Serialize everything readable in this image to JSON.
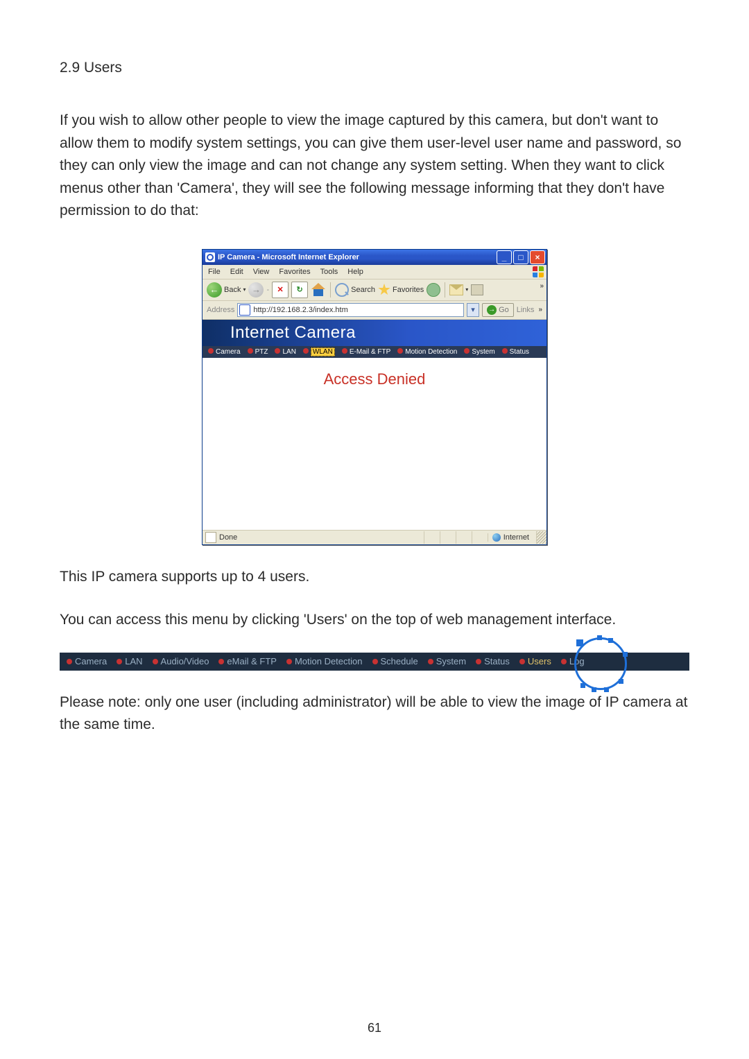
{
  "doc": {
    "section_number_title": "2.9 Users",
    "para1": "If you wish to allow other people to view the image captured by this camera, but don't want to allow them to modify system settings, you can give them user-level user name and password, so they can only view the image and can not change any system setting. When they want to click menus other than 'Camera', they will see the following message informing that they don't have permission to do that:",
    "para2": "This IP camera supports up to 4 users.",
    "para3": "You can access this menu by clicking 'Users' on the top of web management interface.",
    "para4": "Please note: only one user (including administrator) will be able to view the image of IP camera at the same time.",
    "page_number": "61"
  },
  "ie": {
    "title": "IP Camera - Microsoft Internet Explorer",
    "menus": [
      "File",
      "Edit",
      "View",
      "Favorites",
      "Tools",
      "Help"
    ],
    "back_label": "Back",
    "search_label": "Search",
    "favorites_label": "Favorites",
    "address_label": "Address",
    "url": "http://192.168.2.3/index.htm",
    "go_label": "Go",
    "links_label": "Links",
    "overflow": "»",
    "banner": "Internet Camera",
    "nav": {
      "camera": "Camera",
      "ptz": "PTZ",
      "lan": "LAN",
      "wlan": "WLAN",
      "email": "E-Mail & FTP",
      "motion": "Motion Detection",
      "system": "System",
      "status": "Status"
    },
    "access_denied": "Access Denied",
    "status_done": "Done",
    "status_zone": "Internet"
  },
  "wide_nav": {
    "camera": "Camera",
    "lan": "LAN",
    "av": "Audio/Video",
    "email": "eMail & FTP",
    "motion": "Motion Detection",
    "schedule": "Schedule",
    "system": "System",
    "status": "Status",
    "users": "Users",
    "log": "Log"
  }
}
